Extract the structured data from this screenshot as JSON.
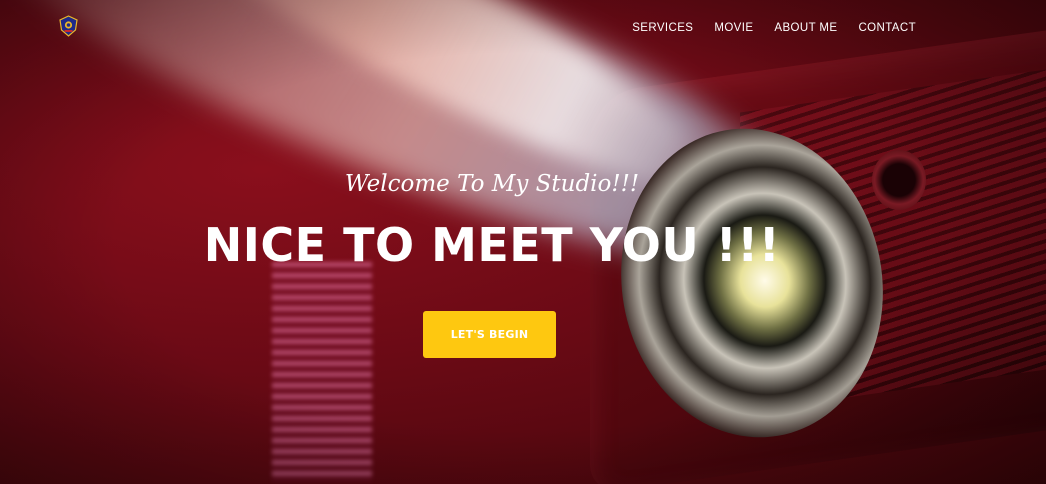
{
  "nav": {
    "logo_icon": "emblem-shield-icon",
    "items": [
      {
        "label": "SERVICES"
      },
      {
        "label": "MOVIE"
      },
      {
        "label": "ABOUT ME"
      },
      {
        "label": "CONTACT"
      }
    ]
  },
  "hero": {
    "subtitle": "Welcome To My Studio!!!",
    "headline": "NICE TO MEET YOU !!!",
    "cta_label": "LET'S BEGIN",
    "cta_color": "#fec810",
    "background_tone": "#6a0a15"
  }
}
